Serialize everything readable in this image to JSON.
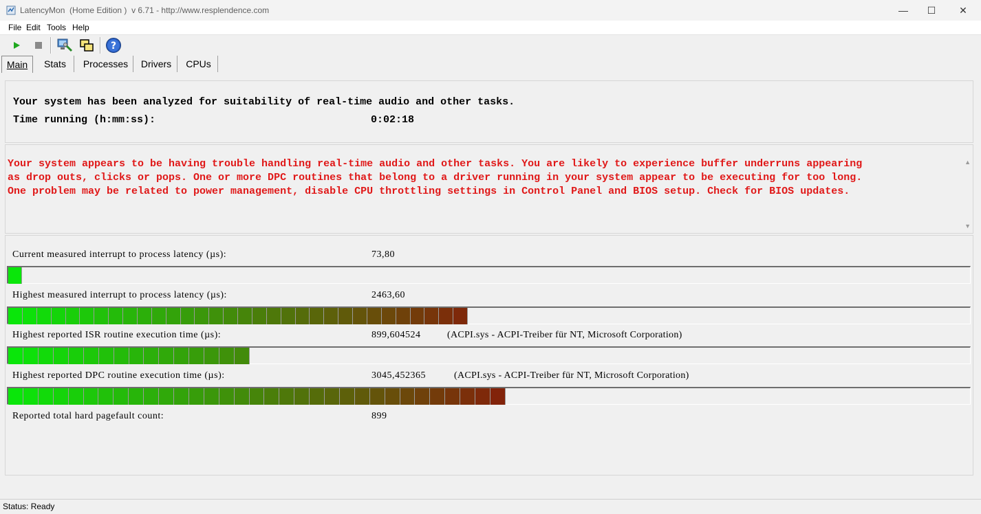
{
  "window": {
    "title": "LatencyMon  (Home Edition )  v 6.71 - http://www.resplendence.com",
    "minimize": "—",
    "maximize": "☐",
    "close": "✕"
  },
  "menu": [
    "File",
    "Edit",
    "Tools",
    "Help"
  ],
  "toolbar": {
    "icons": [
      "play-icon",
      "stop-icon",
      "computer-icon",
      "windows-icon",
      "help-icon"
    ]
  },
  "tabs": [
    "Main",
    "Stats",
    "Processes",
    "Drivers",
    "CPUs"
  ],
  "summary": {
    "analyzed_text": "Your system has been analyzed for suitability of real-time audio and other tasks.",
    "time_label": "Time running (h:mm:ss):",
    "time_value": "0:02:18"
  },
  "warning": {
    "lines": [
      "Your system appears to be having trouble handling real-time audio and other tasks. You are likely to experience buffer underruns appearing",
      "as drop outs, clicks or pops. One or more DPC routines that belong to a driver running in your system appear to be executing for too long.",
      "One problem may be related to power management, disable CPU throttling settings in Control Panel and BIOS setup. Check for BIOS updates."
    ],
    "color": "#e01818"
  },
  "metrics": [
    {
      "label": "Current measured interrupt to process latency (µs):",
      "value": "73,80",
      "extra": "",
      "bar_segments": 1,
      "bar_level": 0.014
    },
    {
      "label": "Highest measured interrupt to process latency (µs):",
      "value": "2463,60",
      "extra": "",
      "bar_segments": 32,
      "bar_level": 0.478
    },
    {
      "label": "Highest reported ISR routine execution time (µs):",
      "value": "899,604524",
      "extra": "(ACPI.sys - ACPI-Treiber für NT, Microsoft Corporation)",
      "bar_segments": 16,
      "bar_level": 0.251
    },
    {
      "label": "Highest reported DPC routine execution time (µs):",
      "value": "3045,452365",
      "extra": "(ACPI.sys - ACPI-Treiber für NT, Microsoft Corporation)",
      "bar_segments": 33,
      "bar_level": 0.517
    },
    {
      "label": "Reported total hard pagefault count:",
      "value": "899",
      "extra": ""
    }
  ],
  "status": "Status: Ready"
}
